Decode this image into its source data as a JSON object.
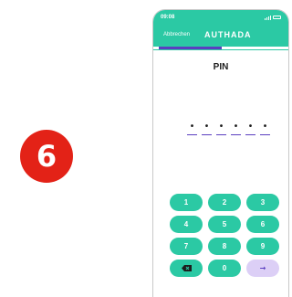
{
  "step": {
    "number": "6"
  },
  "status_bar": {
    "time": "09:08"
  },
  "header": {
    "cancel_label": "Abbrechen",
    "brand": "AUTHADA",
    "progress_fraction": 0.48,
    "color": "#2bc9a4",
    "progress_color": "#5a3fc0"
  },
  "pin": {
    "title": "PIN",
    "digits": [
      "•",
      "•",
      "•",
      "•",
      "•",
      "•"
    ]
  },
  "keypad": {
    "keys": [
      "1",
      "2",
      "3",
      "4",
      "5",
      "6",
      "7",
      "8",
      "9"
    ],
    "zero": "0",
    "delete_icon": "backspace-icon",
    "submit_icon": "arrow-right-icon",
    "submit_glyph": "→"
  },
  "colors": {
    "accent": "#2bc9a4",
    "purple": "#5a3fc0",
    "submit_bg": "#dccff6",
    "badge": "#e32217"
  }
}
